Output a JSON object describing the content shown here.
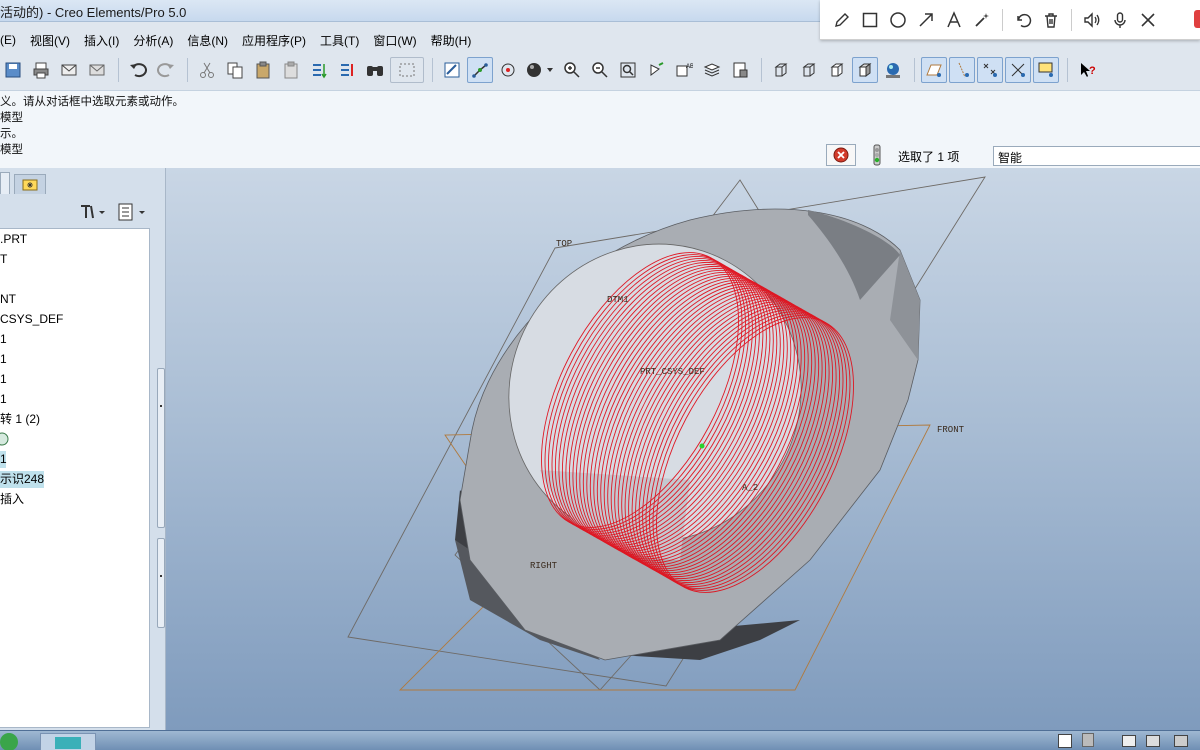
{
  "window": {
    "title": "活动的) - Creo Elements/Pro 5.0"
  },
  "annotation_toolbar": {
    "tools": [
      "pencil-icon",
      "rectangle-icon",
      "circle-icon",
      "arrow-icon",
      "text-icon",
      "magic-wand-icon",
      "undo-icon",
      "trash-icon",
      "speaker-icon",
      "microphone-icon",
      "close-icon"
    ]
  },
  "menu": {
    "items": [
      "(E)",
      "视图(V)",
      "插入(I)",
      "分析(A)",
      "信息(N)",
      "应用程序(P)",
      "工具(T)",
      "窗口(W)",
      "帮助(H)"
    ]
  },
  "messages": {
    "lines": [
      "义。请从对话框中选取元素或动作。",
      "模型",
      "示。",
      "模型"
    ]
  },
  "status": {
    "selected_text": "选取了 1 项",
    "filter_value": "智能"
  },
  "tree": {
    "rows": [
      {
        "label": ".PRT"
      },
      {
        "label": "T"
      },
      {
        "label": ""
      },
      {
        "label": "NT"
      },
      {
        "label": "CSYS_DEF"
      },
      {
        "label": "1"
      },
      {
        "label": "1"
      },
      {
        "label": "1"
      },
      {
        "label": "1"
      },
      {
        "label": "转 1 (2)"
      },
      {
        "label": ""
      },
      {
        "label": "1"
      },
      {
        "label": "示识248"
      },
      {
        "label": "插入"
      }
    ]
  },
  "viewport": {
    "datum_labels": {
      "top": "TOP",
      "front": "FRONT",
      "right": "RIGHT",
      "dtm": "DTM1",
      "csys": "PRT_CSYS_DEF",
      "axis": "A_2"
    },
    "colors": {
      "helix": "#e0101c",
      "datum": "#b07a3e",
      "part": "#a9adb3"
    }
  }
}
